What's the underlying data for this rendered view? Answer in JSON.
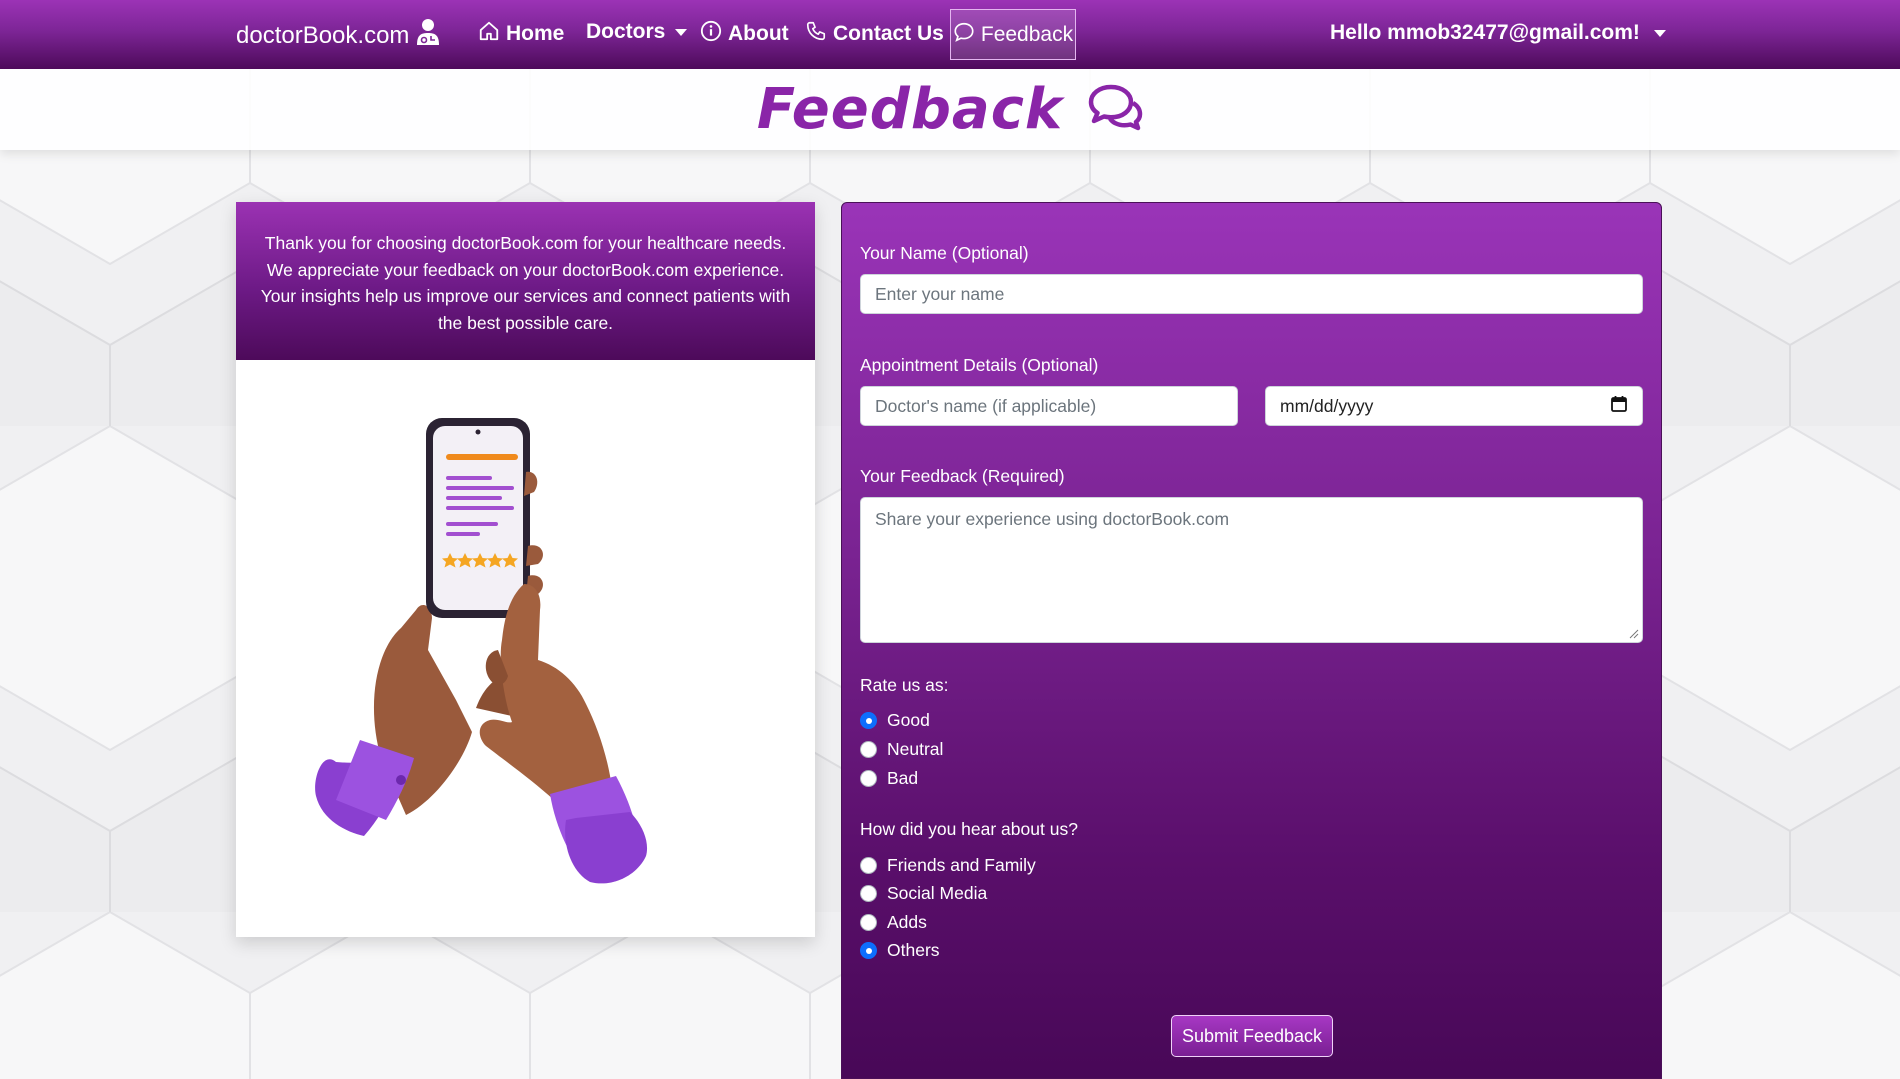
{
  "navbar": {
    "brand": "doctorBook.com",
    "home": "Home",
    "doctors": "Doctors",
    "about": "About",
    "contact": "Contact Us",
    "feedback": "Feedback",
    "user_greeting": "Hello mmob32477@gmail.com!"
  },
  "page": {
    "title": "Feedback"
  },
  "intro": {
    "text": "Thank you for choosing doctorBook.com for your healthcare needs. We appreciate your feedback on your doctorBook.com experience. Your insights help us improve our services and connect patients with the best possible care."
  },
  "form": {
    "name_label": "Your Name (Optional)",
    "name_placeholder": "Enter your name",
    "appointment_label": "Appointment Details (Optional)",
    "doctor_placeholder": "Doctor's name (if applicable)",
    "date_value": "mm/dd/yyyy",
    "feedback_label": "Your Feedback (Required)",
    "feedback_placeholder": "Share your experience using doctorBook.com",
    "rate_label": "Rate us as:",
    "rate_options": [
      "Good",
      "Neutral",
      "Bad"
    ],
    "rate_selected": "Good",
    "hear_label": "How did you hear about us?",
    "hear_options": [
      "Friends and Family",
      "Social Media",
      "Adds",
      "Others"
    ],
    "hear_selected": "Others",
    "submit_label": "Submit Feedback"
  },
  "colors": {
    "accent": "#8a25a8",
    "nav_top": "#9c33b6",
    "nav_bottom": "#4d0a5a",
    "radio_checked": "#0d6efd"
  },
  "icons": [
    "doctor-icon",
    "home-icon",
    "info-icon",
    "phone-icon",
    "chat-icon",
    "chat-bubbles-icon",
    "calendar-icon",
    "caret-down-icon"
  ]
}
